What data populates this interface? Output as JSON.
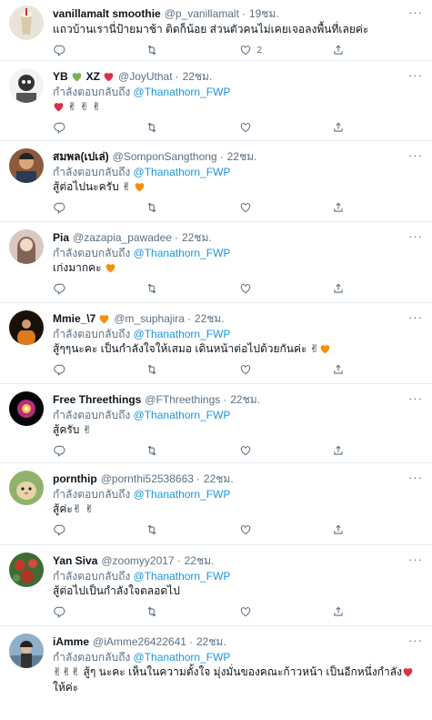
{
  "reply_prefix": "กำลังตอบกลับถึง",
  "tweets": [
    {
      "name": "vanillamalt smoothie",
      "handle": "@p_vanillamalt",
      "time": "19ชม.",
      "reply_to": "",
      "text": "แถวบ้านเรานี่ป้ายมาช้า ติดก็น้อย ส่วนตัวคนไม่เคยเจอลงพื้นที่เลยค่ะ",
      "reply_count": "",
      "retweet_count": "",
      "like_count": "2"
    },
    {
      "name": "YB",
      "name_suffix": "XZ",
      "handle": "@JoyUthat",
      "time": "22ชม.",
      "reply_to": "@Thanathorn_FWP",
      "text": "",
      "emojis": [
        "heart",
        "victory",
        "victory",
        "victory"
      ],
      "reply_count": "",
      "retweet_count": "",
      "like_count": ""
    },
    {
      "name": "สมพล(เปเล่)",
      "handle": "@SomponSangthong",
      "time": "22ชม.",
      "reply_to": "@Thanathorn_FWP",
      "text": "สู้ต่อไปนะครับ",
      "reply_count": "",
      "retweet_count": "",
      "like_count": ""
    },
    {
      "name": "Pia",
      "handle": "@zazapia_pawadee",
      "time": "22ชม.",
      "reply_to": "@Thanathorn_FWP",
      "text": "เก่งมากคะ",
      "reply_count": "",
      "retweet_count": "",
      "like_count": ""
    },
    {
      "name": "Mmie_\\7",
      "handle": "@m_suphajira",
      "time": "22ชม.",
      "reply_to": "@Thanathorn_FWP",
      "text": "สู้ๆๆนะคะ เป็นกำลังใจให้เสมอ เดินหน้าต่อไปด้วยกันค่ะ",
      "reply_count": "",
      "retweet_count": "",
      "like_count": ""
    },
    {
      "name": "Free Threethings",
      "handle": "@FThreethings",
      "time": "22ชม.",
      "reply_to": "@Thanathorn_FWP",
      "text": "สู้ครับ",
      "reply_count": "",
      "retweet_count": "",
      "like_count": ""
    },
    {
      "name": "pornthip",
      "handle": "@pornthi52538663",
      "time": "22ชม.",
      "reply_to": "@Thanathorn_FWP",
      "text": "สู้ค่ะ",
      "reply_count": "",
      "retweet_count": "",
      "like_count": ""
    },
    {
      "name": "Yan Siva",
      "handle": "@zoomyy2017",
      "time": "22ชม.",
      "reply_to": "@Thanathorn_FWP",
      "text": "สู้ต่อไปเป็นกำลังใจตลอดไป",
      "reply_count": "",
      "retweet_count": "",
      "like_count": ""
    },
    {
      "name": "iAmme",
      "handle": "@iAmme26422641",
      "time": "22ชม.",
      "reply_to": "@Thanathorn_FWP",
      "text": "สู้ๆ นะคะ เห็นในความตั้งใจ มุ่งมั่นของคณะก้าวหน้า  เป็นอีกหนึ่งกำลัง",
      "text_line2": "ให้ค่ะ",
      "reply_count": "",
      "retweet_count": "",
      "like_count": ""
    }
  ],
  "colors": {
    "link": "#1b95e0",
    "secondary": "#5b7083",
    "divider": "#e6ecf0",
    "heart_red": "#dd2e44",
    "heart_orange": "#f4900c",
    "heart_green": "#78b159"
  }
}
